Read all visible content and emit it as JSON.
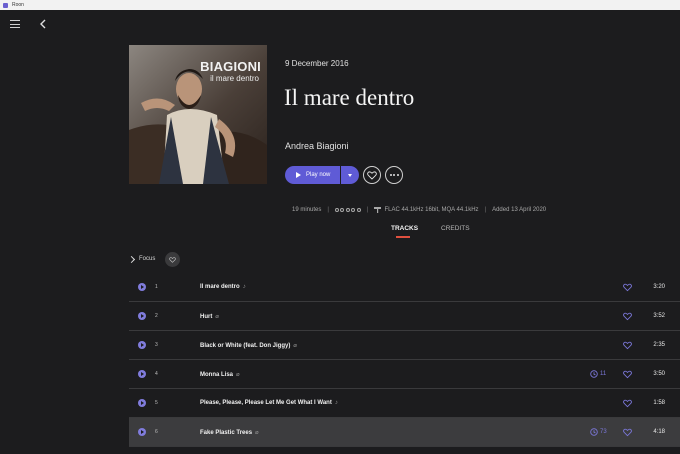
{
  "window": {
    "title": "Roon"
  },
  "nav": {
    "menu_icon": "hamburger-menu-icon",
    "back_icon": "chevron-left-icon"
  },
  "album": {
    "release_date": "9 December 2016",
    "title": "Il mare dentro",
    "artist": "Andrea Biagioni",
    "cover_artist_text": "BIAGIONI",
    "cover_album_text": "il mare dentro"
  },
  "actions": {
    "play_label": "Play now",
    "play_icon": "play-icon",
    "dropdown_icon": "caret-down-icon",
    "favorite_icon": "heart-outline-icon",
    "more_icon": "more-horizontal-icon"
  },
  "meta": {
    "duration": "19 minutes",
    "rating_stars": 0,
    "rating_max": 5,
    "format": "FLAC 44.1kHz 16bit, MQA 44.1kHz",
    "added": "Added 13 April 2020"
  },
  "tabs": [
    {
      "label": "TRACKS",
      "active": true
    },
    {
      "label": "CREDITS",
      "active": false
    }
  ],
  "focus": {
    "label": "Focus",
    "icon": "heart-filter-icon"
  },
  "tracks": [
    {
      "num": "1",
      "title": "Il mare dentro",
      "plays": "",
      "duration": "3:20"
    },
    {
      "num": "2",
      "title": "Hurt",
      "plays": "",
      "duration": "3:52"
    },
    {
      "num": "3",
      "title": "Black or White (feat. Don Jiggy)",
      "plays": "",
      "duration": "2:35"
    },
    {
      "num": "4",
      "title": "Monna Lisa",
      "plays": "11",
      "duration": "3:50"
    },
    {
      "num": "5",
      "title": "Please, Please, Please Let Me Get What I Want",
      "plays": "",
      "duration": "1:58"
    },
    {
      "num": "6",
      "title": "Fake Plastic Trees",
      "plays": "73",
      "duration": "4:18"
    }
  ],
  "colors": {
    "background": "#1c1c1e",
    "accent": "#5f5bd6",
    "tab_underline": "#e0503f",
    "selected_row": "#3c3c3e"
  }
}
